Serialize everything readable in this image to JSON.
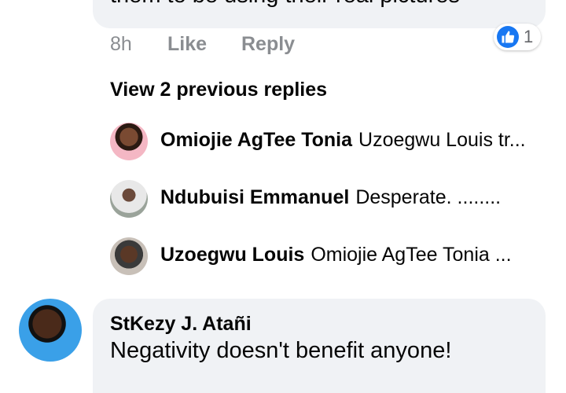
{
  "top_comment": {
    "text": "them to be using their real pictures",
    "time": "8h",
    "like_label": "Like",
    "reply_label": "Reply",
    "reaction_count": "1"
  },
  "view_previous_label": "View 2 previous replies",
  "replies": [
    {
      "name": "Omiojie AgTee Tonia",
      "snippet": "Uzoegwu Louis tr..."
    },
    {
      "name": "Ndubuisi Emmanuel",
      "snippet": "Desperate. ........"
    },
    {
      "name": "Uzoegwu Louis",
      "snippet": "Omiojie AgTee Tonia ..."
    }
  ],
  "bottom_comment": {
    "author": "StKezy J. Atañi",
    "text": "Negativity doesn't benefit anyone!"
  },
  "colors": {
    "accent": "#1877f2",
    "bubble": "#f0f2f5",
    "meta": "#8a8d91"
  }
}
